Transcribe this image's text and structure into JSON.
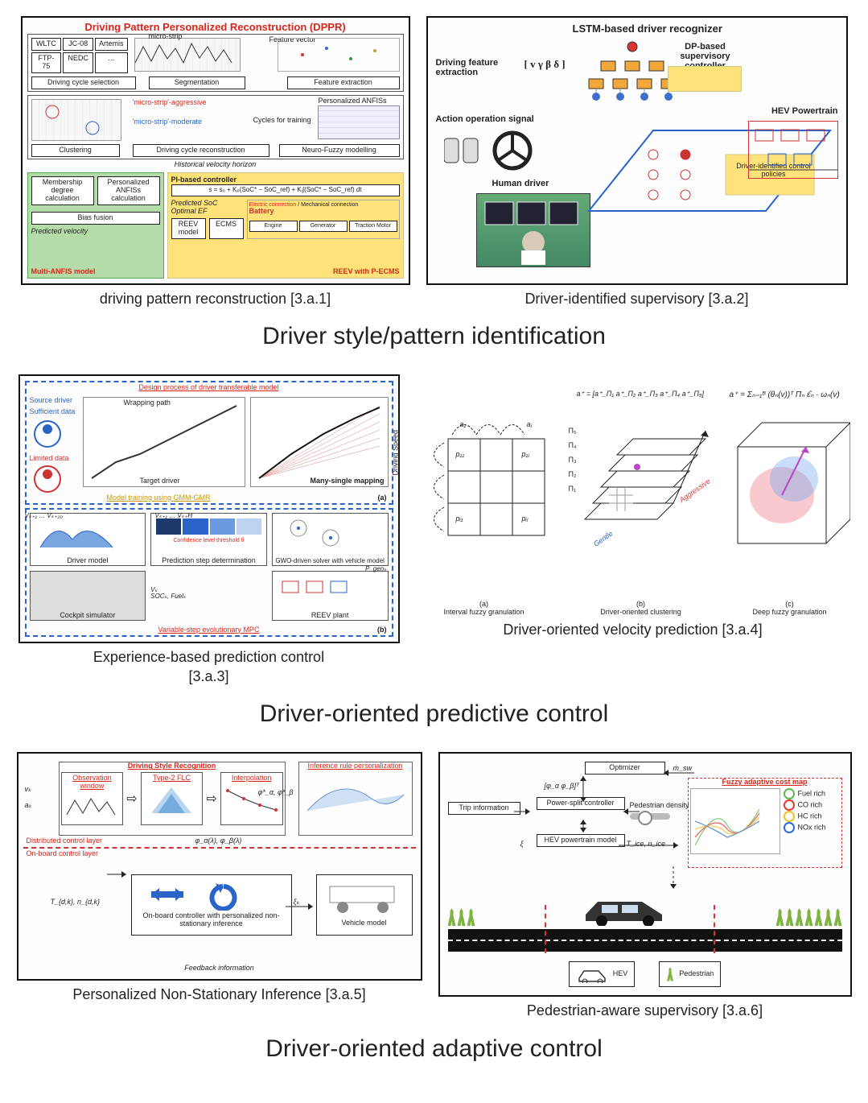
{
  "sections": [
    {
      "title": "Driver style/pattern identification"
    },
    {
      "title": "Driver-oriented predictive control"
    },
    {
      "title": "Driver-oriented adaptive control"
    }
  ],
  "panels": {
    "p1": {
      "caption": "driving pattern reconstruction [3.a.1]",
      "title": "Driving Pattern Personalized Reconstruction (DPPR)",
      "row1": {
        "cycles": [
          "WLTC",
          "JC-08",
          "Artemis",
          "FTP-75",
          "NEDC",
          "..."
        ],
        "labels": [
          "Driving cycle selection",
          "Segmentation",
          "Feature extraction"
        ],
        "micro": "micro-strip",
        "fv": "Feature vector"
      },
      "row2": {
        "labels": [
          "Clustering",
          "Driving cycle reconstruction",
          "Neuro-Fuzzy modelling"
        ],
        "agg": "'micro-strip'-aggressive",
        "mod": "'micro-strip'-moderate",
        "cycles": "Cycles for training",
        "anfis": "Personalized ANFISs"
      },
      "history": "Historical velocity horizon",
      "row3": {
        "multi": "Multi-ANFIS model",
        "mem": "Membership degree calculation",
        "anfis_calc": "Personalized ANFISs calculation",
        "bias": "Bias fusion",
        "predv": "Predicted velocity",
        "pi": "PI-based controller",
        "pi_eq": "s = s₀ + Kₚ(SoC* − SoC_ref) + Kᵢ∫(SoC* − SoC_ref) dt",
        "soc": "Predicted SoC",
        "ef": "Optimal EF",
        "reev": "REEV model",
        "ecms": "ECMS",
        "reev_p": "REEV with P-ECMS",
        "elec": "Electric connection",
        "mech": "Mechanical connection",
        "parts": [
          "Engine",
          "Generator",
          "Traction Motor",
          "Battery"
        ]
      }
    },
    "p2": {
      "caption": "Driver-identified supervisory [3.a.2]",
      "lstm": "LSTM-based driver recognizer",
      "feat": "Driving feature extraction",
      "feat_v": "[ v  γ  β  δ ]",
      "action": "Action operation signal",
      "human": "Human driver",
      "dp": "DP-based supervisory controller",
      "policies": "Driver-identified control policies",
      "hev": "HEV Powertrain"
    },
    "p3": {
      "caption": "Experience-based prediction control\n[3.a.3]",
      "design": "Design process of driver transferable model",
      "wrap": "Wrapping path",
      "source": "Source driver",
      "suff": "Sufficient data",
      "limited": "Limited data",
      "target": "Target driver",
      "many": "Many-single mapping",
      "gmm": "Model training using GMM-GMR",
      "ylabel": "Driving Speed",
      "mpc": "Variable-step evolutionary MPC",
      "boxes": {
        "driver": "Driver model",
        "pred": "Prediction step determination",
        "gwo": "GWO-driven solver with vehicle model",
        "cockpit": "Cockpit simulator",
        "reev": "REEV plant",
        "conf": "Confidence level threshold θ"
      },
      "syms": {
        "vk": "Vₖ",
        "vk1": "Vₖ₊₁ … Vₖ₊₂₀",
        "vkh": "Vₖ₊₁ … Vₖ₊H",
        "soc": "SOCₖ, Fuelₖ",
        "pg": "P_genₖ"
      },
      "ab": {
        "a": "(a)",
        "b": "(b)"
      }
    },
    "p4": {
      "caption": "Driver-oriented velocity prediction [3.a.4]",
      "aplus": "a⁺ = [a⁺_Π₁  a⁺_Π₂  a⁺_Π₃  a⁺_Π₄  a⁺_Π₅]",
      "planes": [
        "Π₁",
        "Π₂",
        "Π₃",
        "Π₄",
        "Π₅"
      ],
      "aplus_sum": "a⁺ = Σₙ₌₁ᴮ (θₙ(v))ᵀ Πₙ ε̂ₙ · ωₙ(v)",
      "matrix": {
        "a1": "a₁",
        "aj": "aⱼ",
        "p11": "p₁₁",
        "p1j": "p₁ⱼ",
        "pi1": "pᵢ₁",
        "pij": "pᵢⱼ"
      },
      "styles": {
        "agg": "Aggressive",
        "gentle": "Gentle"
      },
      "subs": {
        "a": "(a)",
        "a_label": "Interval fuzzy granulation",
        "b": "(b)",
        "b_label": "Driver-oriented clustering",
        "c": "(c)",
        "c_label": "Deep fuzzy granulation"
      }
    },
    "p5": {
      "caption": "Personalized Non-Stationary Inference [3.a.5]",
      "dsr": "Driving Style Recognition",
      "obs": "Observation window",
      "flc": "Type-2 FLC",
      "interp": "Interpolation",
      "rule": "Inference rule personalization",
      "vk": "vₖ",
      "ak": "aₖ",
      "phi_star": "φ*_α, φ*_β",
      "phi": "φ_α(λ), φ_β(λ)",
      "dist": "Distributed control layer",
      "onboard_layer": "On-board control layer",
      "tdk": "T_{d,k}, n_{d,k}",
      "onboard": "On-board controller with personalized non-stationary inference",
      "xi": "ξₖ",
      "vmodel": "Vehicle model",
      "feedback": "Feedback information"
    },
    "p6": {
      "caption": "Pedestrian-aware supervisory [3.a.6]",
      "opt": "Optimizer",
      "msw": "ṁ_sw",
      "phi": "[φ_α  φ_β]ᵀ",
      "trip": "Trip information",
      "split": "Power-split controller",
      "pd": "Pedestrian density",
      "xi": "ξ",
      "model": "HEV powertrain model",
      "tn": "T_ice, n_ice",
      "map": "Fuzzy adaptive cost map",
      "legend": [
        "Fuel rich",
        "CO rich",
        "HC rich",
        "NOx rich"
      ],
      "legend_colors": [
        "#5fb84e",
        "#e83a2f",
        "#f2c22b",
        "#2a6fd6"
      ],
      "hev": "HEV",
      "ped": "Pedestrian"
    }
  }
}
